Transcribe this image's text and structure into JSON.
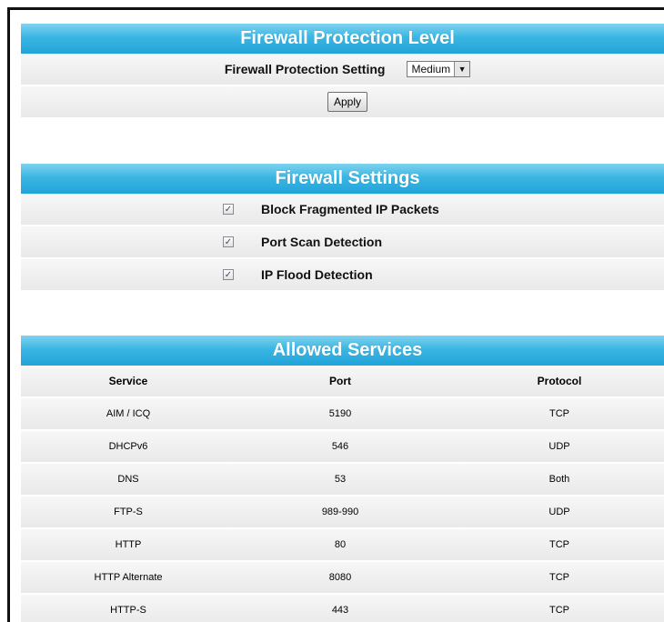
{
  "protection": {
    "title": "Firewall Protection Level",
    "setting_label": "Firewall Protection Setting",
    "setting_value": "Medium",
    "apply_label": "Apply"
  },
  "settings": {
    "title": "Firewall Settings",
    "items": [
      {
        "label": "Block Fragmented IP Packets",
        "checked": true
      },
      {
        "label": "Port Scan Detection",
        "checked": true
      },
      {
        "label": "IP Flood Detection",
        "checked": true
      }
    ]
  },
  "services": {
    "title": "Allowed Services",
    "columns": [
      "Service",
      "Port",
      "Protocol"
    ],
    "rows": [
      [
        "AIM / ICQ",
        "5190",
        "TCP"
      ],
      [
        "DHCPv6",
        "546",
        "UDP"
      ],
      [
        "DNS",
        "53",
        "Both"
      ],
      [
        "FTP-S",
        "989-990",
        "UDP"
      ],
      [
        "HTTP",
        "80",
        "TCP"
      ],
      [
        "HTTP Alternate",
        "8080",
        "TCP"
      ],
      [
        "HTTP-S",
        "443",
        "TCP"
      ]
    ]
  }
}
